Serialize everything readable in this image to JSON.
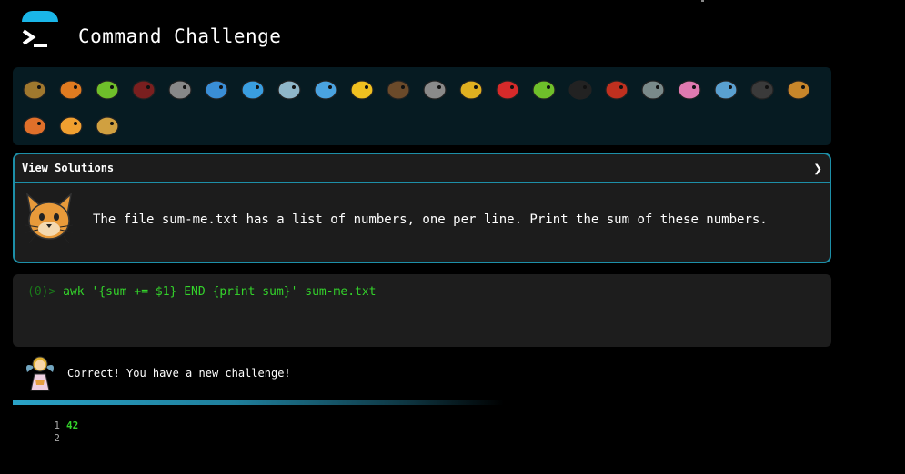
{
  "app": {
    "title": "Command Challenge"
  },
  "emoji_bar": {
    "items": [
      {
        "name": "snail-emoji",
        "color": "#a0782e"
      },
      {
        "name": "butterfly-emoji",
        "color": "#e07b20"
      },
      {
        "name": "caterpillar-emoji",
        "color": "#6fbf2a"
      },
      {
        "name": "ant-emoji",
        "color": "#7a1f1f"
      },
      {
        "name": "spider-web-emoji",
        "color": "#888888"
      },
      {
        "name": "whale-emoji",
        "color": "#3a8ed6"
      },
      {
        "name": "shark-emoji",
        "color": "#3a9ee0"
      },
      {
        "name": "dolphin-emoji",
        "color": "#8fb6c8"
      },
      {
        "name": "fish-emoji",
        "color": "#4aa3e0"
      },
      {
        "name": "tropical-fish-emoji",
        "color": "#f0c020"
      },
      {
        "name": "blowfish-emoji",
        "color": "#6b4a2a"
      },
      {
        "name": "wolf-emoji",
        "color": "#8a8a8a"
      },
      {
        "name": "bee-emoji",
        "color": "#e0b020"
      },
      {
        "name": "ladybug-emoji",
        "color": "#d62a2a"
      },
      {
        "name": "cricket-emoji",
        "color": "#6fbf2a"
      },
      {
        "name": "spider-emoji",
        "color": "#222222"
      },
      {
        "name": "scorpion-emoji",
        "color": "#c0301f"
      },
      {
        "name": "fly-emoji",
        "color": "#7a8a8a"
      },
      {
        "name": "worm-emoji",
        "color": "#e07ab0"
      },
      {
        "name": "microbe-emoji",
        "color": "#5aa0d0"
      },
      {
        "name": "gorilla-emoji",
        "color": "#3a3a3a"
      },
      {
        "name": "dog-emoji",
        "color": "#c8862a"
      },
      {
        "name": "fox-emoji",
        "color": "#e0702a"
      },
      {
        "name": "cat-emoji",
        "color": "#f0a030"
      },
      {
        "name": "lion-emoji",
        "color": "#d0a040"
      }
    ]
  },
  "solutions_panel": {
    "label": "View Solutions",
    "chevron": "❯",
    "challenge_text": "The file sum-me.txt has a list of numbers, one per line. Print the sum of these numbers."
  },
  "terminal": {
    "prompt": "(0)>",
    "command": "awk '{sum += $1} END {print sum}' sum-me.txt"
  },
  "feedback": {
    "message": "Correct! You have a new challenge!"
  },
  "output": {
    "line_numbers": [
      "1",
      "2"
    ],
    "value": "42"
  },
  "colors": {
    "accent": "#1ab6e8",
    "border": "#1d8fa8",
    "command_green": "#34d42b",
    "emoji_bar_bg": "#061b22",
    "terminal_bg": "#1d1d1d"
  }
}
